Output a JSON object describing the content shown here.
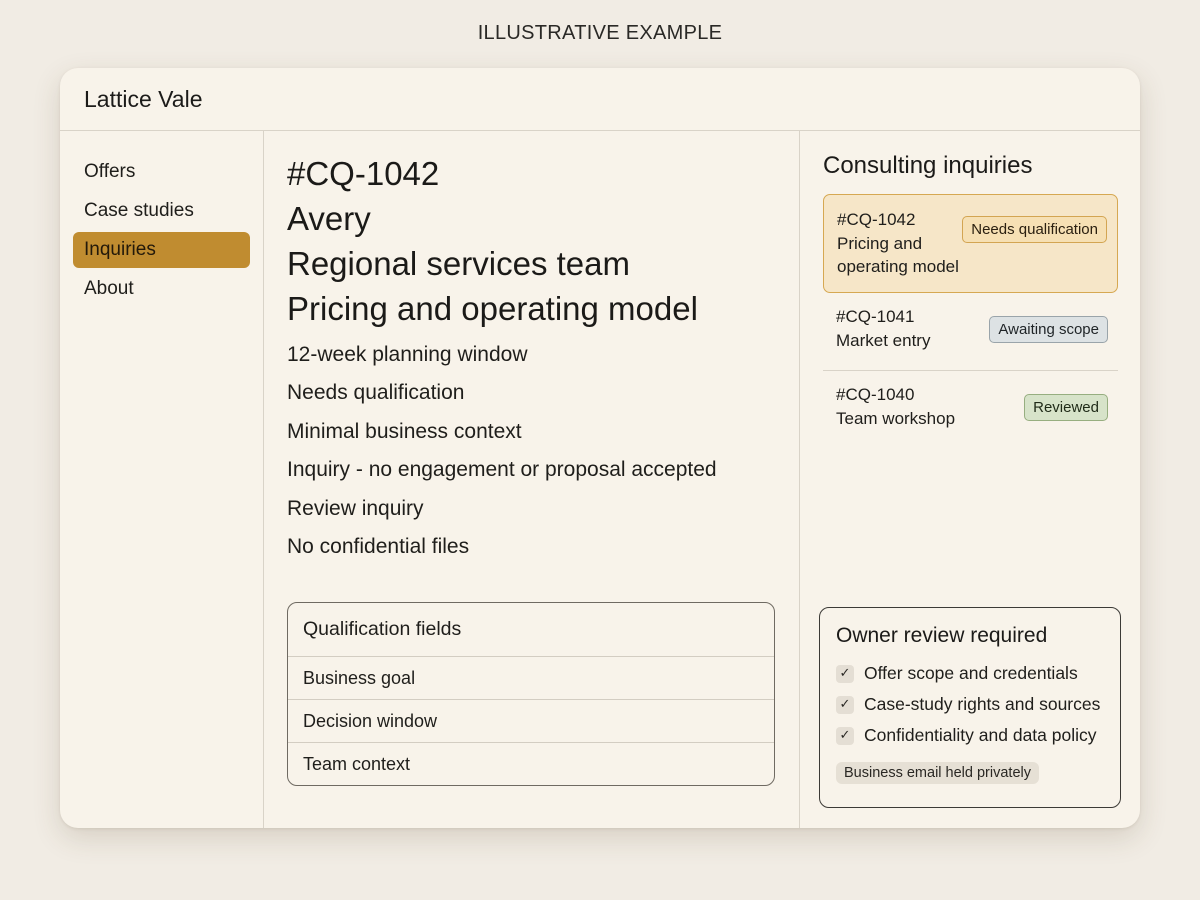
{
  "banner": "ILLUSTRATIVE EXAMPLE",
  "app": {
    "title": "Lattice Vale"
  },
  "sidebar": {
    "items": [
      {
        "label": "Offers",
        "active": false
      },
      {
        "label": "Case studies",
        "active": false
      },
      {
        "label": "Inquiries",
        "active": true
      },
      {
        "label": "About",
        "active": false
      }
    ]
  },
  "detail": {
    "id": "#CQ-1042",
    "name": "Avery",
    "team": "Regional services team",
    "topic": "Pricing and operating model",
    "facts": [
      "12-week planning window",
      "Needs qualification",
      "Minimal business context",
      "Inquiry - no engagement or proposal accepted",
      "Review inquiry",
      "No confidential files"
    ],
    "qualification": {
      "title": "Qualification fields",
      "fields": [
        "Business goal",
        "Decision window",
        "Team context"
      ]
    }
  },
  "inquiries": {
    "title": "Consulting inquiries",
    "items": [
      {
        "id": "#CQ-1042",
        "line1": "Pricing and",
        "line2": "operating model",
        "status": "Needs qualification",
        "status_color": "#f6e0b4"
      },
      {
        "id": "#CQ-1041",
        "line1": "Market entry",
        "line2": "",
        "status": "Awaiting scope",
        "status_color": "#dde2e4"
      },
      {
        "id": "#CQ-1040",
        "line1": "Team workshop",
        "line2": "",
        "status": "Reviewed",
        "status_color": "#d7e3c9"
      }
    ]
  },
  "owner_review": {
    "title": "Owner review required",
    "checks": [
      "Offer scope and credentials",
      "Case-study rights and sources",
      "Confidentiality and data policy"
    ],
    "check_icon": "check-icon",
    "note": "Business email held privately"
  },
  "colors": {
    "accent": "#c08c30",
    "background": "#f1ece4",
    "panel": "#f8f3ea"
  }
}
